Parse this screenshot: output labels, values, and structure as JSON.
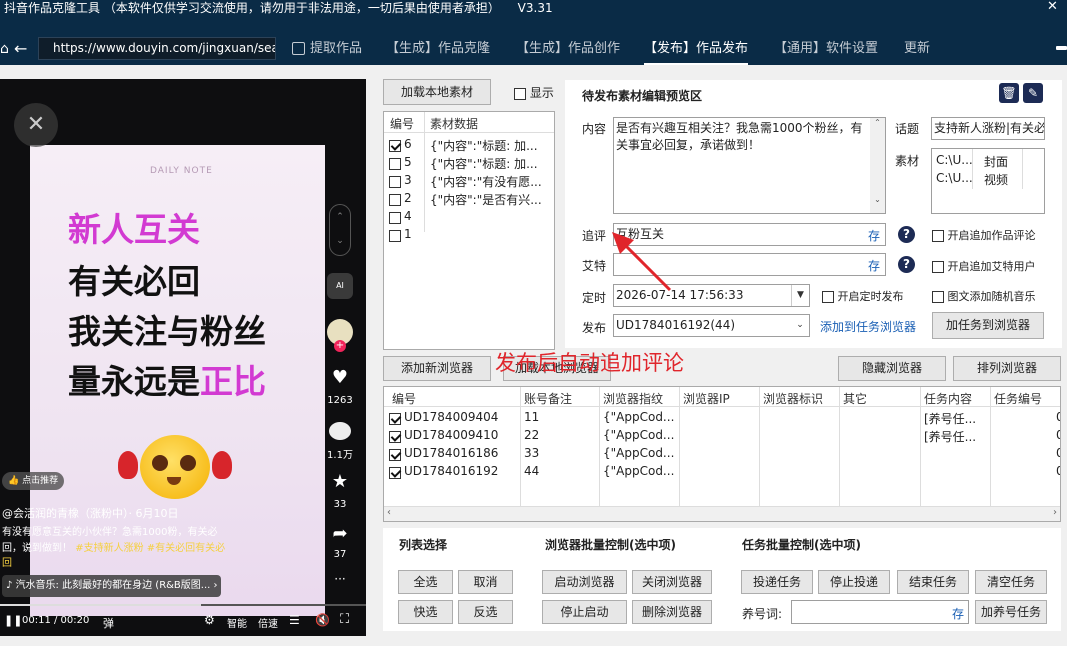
{
  "app": {
    "title": "抖音作品克隆工具 （本软件仅供学习交流使用，请勿用于非法用途，一切后果由使用者承担）",
    "version": "V3.31"
  },
  "nav": {
    "url": "https://www.douyin.com/jingxuan/sea",
    "tabs": [
      "提取作品",
      "【生成】作品克隆",
      "【生成】作品创作",
      "【发布】作品发布",
      "【通用】软件设置",
      "更新"
    ]
  },
  "video": {
    "daily_note": "DAILY NOTE",
    "line1": "新人互关",
    "line2": "有关必回",
    "line3": "我关注与粉丝",
    "line4a": "量永远是",
    "line4b": "正比",
    "likes": "1263",
    "comments": "1.1万",
    "favorites": "33",
    "shares": "37",
    "recommend": "点击推荐",
    "author": "@会活润的青橡（涨粉中）· 6月10日",
    "desc1": "有没有愿意互关的小伙伴？急需1000粉，有关必",
    "desc2": "回，说到做到！",
    "tag1": "#支持新人涨粉",
    "tag2": "#有关必回有关必",
    "desc3": "回",
    "music": "汽水音乐: 此刻最好的都在身边 (R&B版图...",
    "time": "00:11 / 00:20",
    "danmu": "弹",
    "smart": "智能",
    "speed": "倍速",
    "ai": "AI"
  },
  "material": {
    "load_button": "加载本地素材",
    "show_label": "显示",
    "col_id": "编号",
    "col_data": "素材数据",
    "rows": [
      {
        "id": "6",
        "checked": true,
        "data": "{\"内容\":\"标题:  加..."
      },
      {
        "id": "5",
        "checked": false,
        "data": "{\"内容\":\"标题: 加..."
      },
      {
        "id": "3",
        "checked": false,
        "data": "{\"内容\":\"有没有愿..."
      },
      {
        "id": "2",
        "checked": false,
        "data": "{\"内容\":\"是否有兴..."
      },
      {
        "id": "4",
        "checked": false,
        "data": ""
      },
      {
        "id": "1",
        "checked": false,
        "data": ""
      }
    ]
  },
  "preview": {
    "title": "待发布素材编辑预览区",
    "content_label": "内容",
    "content_text": "是否有兴趣互相关注？我急需1000个粉丝，有关事宜必回复，承诺做到！",
    "topic_label": "话题",
    "topic_value": "支持新人涨粉|有关必",
    "asset_label": "素材",
    "assets": [
      {
        "path": "C:\\U...",
        "type": "封面"
      },
      {
        "path": "C:\\U...",
        "type": "视频"
      }
    ],
    "comment_label": "追评",
    "comment_value": "互粉互关",
    "save_label": "存",
    "aite_label": "艾特",
    "aite_value": "",
    "help": "?",
    "opt_comment": "开启追加作品评论",
    "opt_aite": "开启追加艾特用户",
    "time_label": "定时",
    "time_value": "2026-07-14 17:56:33",
    "opt_timed": "开启定时发布",
    "opt_music": "图文添加随机音乐",
    "publish_label": "发布",
    "publish_value": "UD1784016192(44)",
    "add_to_task": "添加到任务浏览器",
    "add_task_button": "加任务到浏览器"
  },
  "annotation": "发布后自动追加评论",
  "browser_toolbar": {
    "add_new": "添加新浏览器",
    "load_local": "加载本地浏览器",
    "hide": "隐藏浏览器",
    "arrange": "排列浏览器"
  },
  "browser_table": {
    "columns": [
      "编号",
      "账号备注",
      "浏览器指纹",
      "浏览器IP",
      "浏览器标识",
      "其它",
      "任务内容",
      "任务编号"
    ],
    "rows": [
      {
        "id": "UD1784009404",
        "note": "11",
        "fp": "{\"AppCod...",
        "ip": "",
        "mark": "",
        "other": "",
        "task": "[养号任...",
        "taskno": "",
        "extra": "0"
      },
      {
        "id": "UD1784009410",
        "note": "22",
        "fp": "{\"AppCod...",
        "ip": "",
        "mark": "",
        "other": "",
        "task": "[养号任...",
        "taskno": "",
        "extra": "0"
      },
      {
        "id": "UD1784016186",
        "note": "33",
        "fp": "{\"AppCod...",
        "ip": "",
        "mark": "",
        "other": "",
        "task": "",
        "taskno": "",
        "extra": "0"
      },
      {
        "id": "UD1784016192",
        "note": "44",
        "fp": "{\"AppCod...",
        "ip": "",
        "mark": "",
        "other": "",
        "task": "",
        "taskno": "",
        "extra": "0"
      }
    ]
  },
  "controls": {
    "list_title": "列表选择",
    "browser_title": "浏览器批量控制(选中项)",
    "task_title": "任务批量控制(选中项)",
    "select_all": "全选",
    "cancel": "取消",
    "quick_select": "快选",
    "invert": "反选",
    "start_browser": "启动浏览器",
    "close_browser": "关闭浏览器",
    "stop_start": "停止启动",
    "delete_browser": "删除浏览器",
    "deliver_task": "投递任务",
    "stop_deliver": "停止投递",
    "end_task": "结束任务",
    "clear_task": "清空任务",
    "nurture_label": "养号词:",
    "nurture_value": "",
    "save": "存",
    "add_nurture": "加养号任务"
  }
}
